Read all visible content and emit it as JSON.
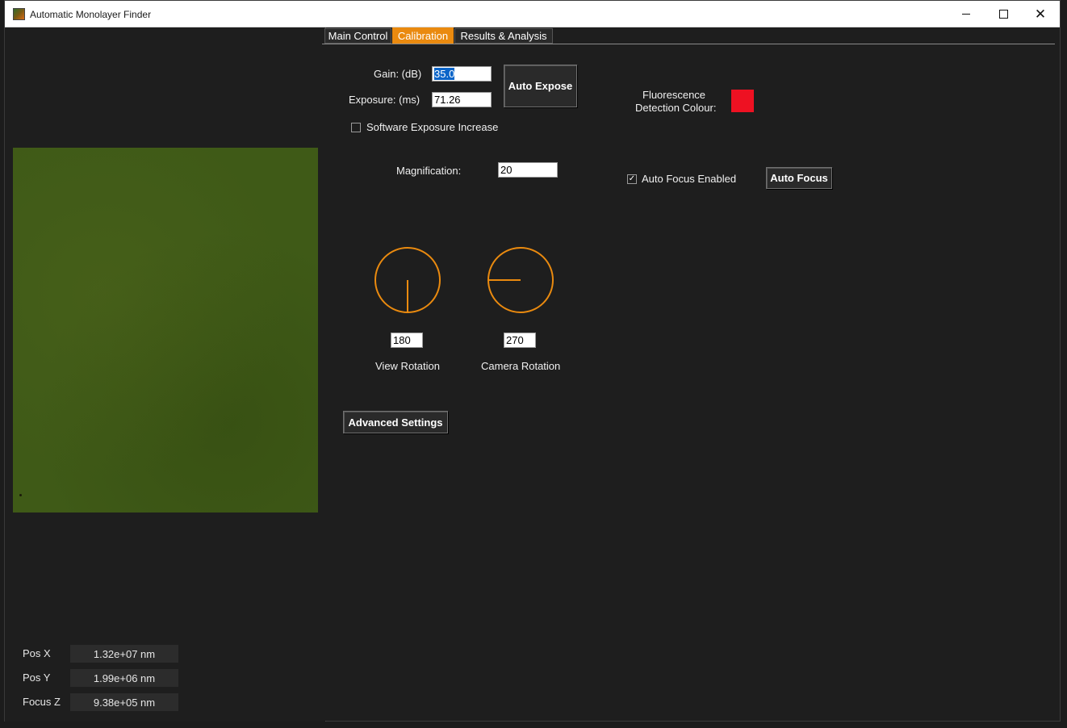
{
  "window": {
    "title": "Automatic Monolayer Finder"
  },
  "positions": [
    {
      "label": "Pos X",
      "value": "1.32e+07 nm"
    },
    {
      "label": "Pos Y",
      "value": "1.99e+06 nm"
    },
    {
      "label": "Focus Z",
      "value": "9.38e+05 nm"
    }
  ],
  "tabs": [
    {
      "label": "Main Control",
      "active": false
    },
    {
      "label": "Calibration",
      "active": true
    },
    {
      "label": "Results & Analysis",
      "active": false
    }
  ],
  "calibration": {
    "gain_label": "Gain: (dB)",
    "gain_value": "35.0",
    "exposure_label": "Exposure: (ms)",
    "exposure_value": "71.26",
    "auto_expose_label": "Auto Expose",
    "software_exposure_label": "Software Exposure Increase",
    "software_exposure_checked": false,
    "fluorescence_label_line1": "Fluorescence",
    "fluorescence_label_line2": "Detection Colour:",
    "fluorescence_colour": "#ee1122",
    "magnification_label": "Magnification:",
    "magnification_value": "20",
    "auto_focus_enabled_label": "Auto Focus Enabled",
    "auto_focus_enabled_checked": true,
    "auto_focus_label": "Auto Focus",
    "view_rotation_label": "View Rotation",
    "view_rotation_value": "180",
    "camera_rotation_label": "Camera Rotation",
    "camera_rotation_value": "270",
    "advanced_settings_label": "Advanced Settings"
  },
  "colors": {
    "accent": "#ea8a0f",
    "background": "#1e1e1e",
    "camera": "#3f5a17"
  }
}
